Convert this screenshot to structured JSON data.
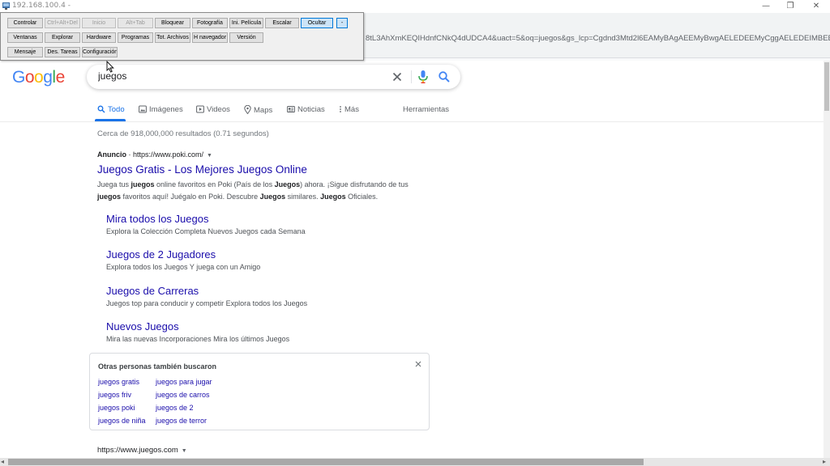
{
  "window": {
    "title": "192.168.100.4 -",
    "minimize": "—",
    "maximize": "❐",
    "close": "✕"
  },
  "browser": {
    "url_fragment": "8tL3AhXmKEQIHdnfCNkQ4dUDCA4&uact=5&oq=juegos&gs_lcp=Cgdnd3Mtd2l6EAMyBAgAEEMyBwgAELEDEEMyCggAELEDEIMBEEMyB"
  },
  "control_panel": {
    "row1": [
      "Controlar",
      "Ctrl+Alt+Del",
      "Inicio",
      "Alt+Tab",
      "Bloquear",
      "Fotografía",
      "Ini. Película",
      "Escalar",
      "Ocultar",
      "-"
    ],
    "row2": [
      "Ventanas",
      "Explorar",
      "Hardware",
      "Programas",
      "Tot. Archivos",
      "H navegador",
      "Versión"
    ],
    "row3": [
      "Mensaje",
      "Des. Tareas",
      "Configuración"
    ]
  },
  "google": {
    "logo_letters": [
      "G",
      "o",
      "o",
      "g",
      "l",
      "e"
    ],
    "logo_colors": [
      "#4285F4",
      "#EA4335",
      "#FBBC05",
      "#4285F4",
      "#34A853",
      "#EA4335"
    ],
    "query": "juegos"
  },
  "tabs": [
    "Todo",
    "Imágenes",
    "Videos",
    "Maps",
    "Noticias",
    "Más",
    "Herramientas"
  ],
  "results": {
    "stats": "Cerca de 918,000,000 resultados (0.71 segundos)",
    "ad": {
      "label": "Anuncio",
      "separator": " · ",
      "url": "https://www.poki.com/",
      "caret": "▼",
      "title": "Juegos Gratis - Los Mejores Juegos Online",
      "snippet": [
        {
          "t": "Juega tus ",
          "b": false
        },
        {
          "t": "juegos",
          "b": true
        },
        {
          "t": " online favoritos en Poki (País de los ",
          "b": false
        },
        {
          "t": "Juegos",
          "b": true
        },
        {
          "t": ") ahora. ¡Sigue disfrutando de tus ",
          "b": false
        },
        {
          "t": "juegos",
          "b": true
        },
        {
          "t": " favoritos aquí! Juégalo en Poki. Descubre ",
          "b": false
        },
        {
          "t": "Juegos",
          "b": true
        },
        {
          "t": " similares. ",
          "b": false
        },
        {
          "t": "Juegos",
          "b": true
        },
        {
          "t": " Oficiales.",
          "b": false
        }
      ]
    },
    "sitelinks": [
      {
        "title": "Mira todos los Juegos",
        "desc": "Explora la Colección Completa Nuevos Juegos cada Semana"
      },
      {
        "title": "Juegos de 2 Jugadores",
        "desc": "Explora todos los Juegos Y juega con un Amigo"
      },
      {
        "title": "Juegos de Carreras",
        "desc": "Juegos top para conducir y competir Explora todos los Juegos"
      },
      {
        "title": "Nuevos Juegos",
        "desc": "Mira las nuevas Incorporaciones Mira los últimos Juegos"
      }
    ],
    "also_searched": {
      "title": "Otras personas también buscaron",
      "col1": [
        "juegos gratis",
        "juegos friv",
        "juegos poki",
        "juegos de niña"
      ],
      "col2": [
        "juegos para jugar",
        "juegos de carros",
        "juegos de 2",
        "juegos de terror"
      ]
    },
    "second_url": "https://www.juegos.com",
    "second_caret": "▼"
  },
  "scrollbar": {
    "left_arrow": "◂",
    "right_arrow": "▸"
  }
}
